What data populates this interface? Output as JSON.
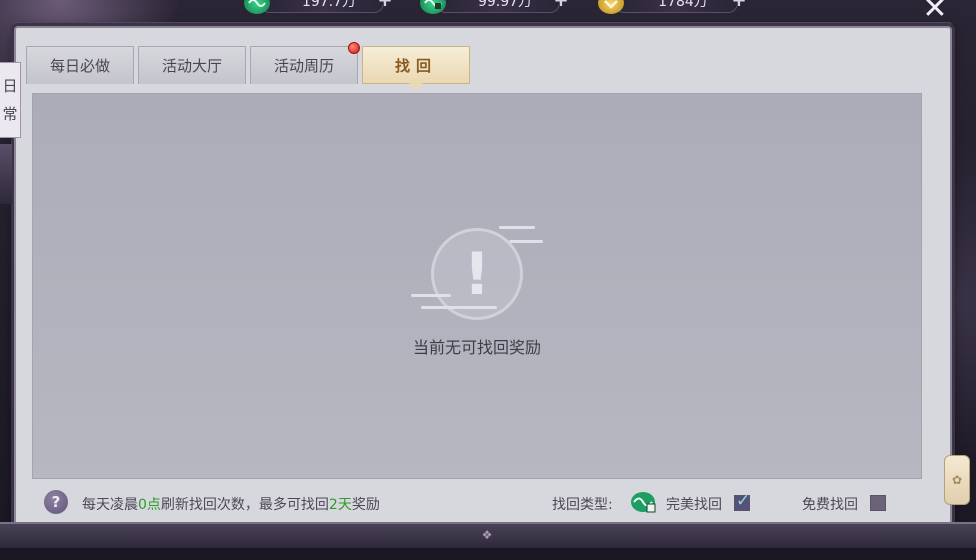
{
  "currencies": [
    {
      "icon": "jade-coin-icon",
      "value": "197.7万"
    },
    {
      "icon": "bound-jade-icon",
      "value": "99.97万"
    },
    {
      "icon": "gold-ingot-icon",
      "value": "1784万"
    }
  ],
  "side_tab": {
    "chars": [
      "日",
      "常"
    ]
  },
  "tabs": [
    {
      "label": "每日必做",
      "active": false
    },
    {
      "label": "活动大厅",
      "active": false
    },
    {
      "label": "活动周历",
      "active": false,
      "badge": true
    },
    {
      "label": "找回",
      "active": true
    }
  ],
  "content": {
    "empty_message": "当前无可找回奖励"
  },
  "footer": {
    "notice_parts": [
      "每天凌晨",
      "0点",
      "刷新找回次数，最多可找回",
      "2天",
      "奖励"
    ],
    "type_label": "找回类型:",
    "perfect_label": "完美找回",
    "perfect_checked": true,
    "free_label": "免费找回",
    "free_checked": false
  },
  "colors": {
    "highlight_green": "#2e9a2a",
    "active_tab_text": "#8a5a1e",
    "badge_red": "#d21a12"
  }
}
